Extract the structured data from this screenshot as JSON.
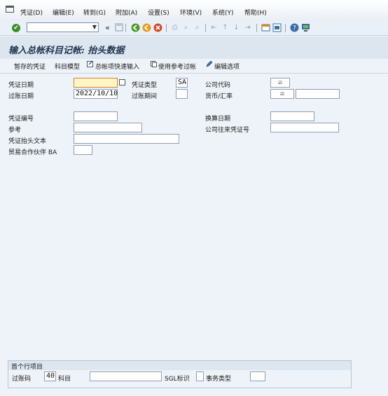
{
  "menu": {
    "items": [
      "凭证(D)",
      "编辑(E)",
      "转到(G)",
      "附加(A)",
      "设置(S)",
      "环境(V)",
      "系统(Y)",
      "帮助(H)"
    ]
  },
  "toolbar": {
    "command_value": "",
    "icons": [
      "enter-icon",
      "save-icon",
      "back-icon",
      "exit-icon",
      "cancel-icon",
      "print-icon",
      "find-icon",
      "find-next-icon",
      "first-page-icon",
      "prev-page-icon",
      "next-page-icon",
      "last-page-icon",
      "new-session-icon",
      "shortcut-icon",
      "help-icon",
      "layout-icon"
    ],
    "colors": {
      "back": "#4c9a2a",
      "exit": "#e79c1b",
      "cancel": "#d24a2a"
    }
  },
  "title": "输入总帐科目记帐: 抬头数据",
  "app_toolbar": {
    "held_document": "暂存的凭证",
    "account_model": "科目模型",
    "gl_fast_entry": "总帐项快速输入",
    "post_with_reference": "使用参考过帐",
    "editing_options": "编辑选项"
  },
  "header": {
    "doc_date_label": "凭证日期",
    "doc_date_value": "",
    "doc_type_label": "凭证类型",
    "doc_type_value": "SA",
    "company_code_label": "公司代码",
    "company_code_value": "☑",
    "posting_date_label": "过账日期",
    "posting_date_value": "2022/10/10",
    "period_label": "过账期间",
    "period_value": "",
    "currency_label": "货币/汇率",
    "currency_value": "☑",
    "rate_value": "",
    "doc_number_label": "凭证编号",
    "doc_number_value": "",
    "translation_date_label": "换算日期",
    "translation_date_value": "",
    "reference_label": "参考",
    "reference_value": "",
    "cross_cc_label": "公司往来凭证号",
    "cross_cc_value": "",
    "header_text_label": "凭证抬头文本",
    "header_text_value": "",
    "trading_partner_label": "贸易合作伙伴 BA",
    "trading_partner_value": ""
  },
  "first_line": {
    "group_title": "首个行项目",
    "posting_key_label": "过账码",
    "posting_key_value": "40",
    "account_label": "科目",
    "account_value": "",
    "sgl_label": "SGL标识",
    "sgl_value": "",
    "trans_type_label": "事务类型",
    "trans_type_value": ""
  }
}
